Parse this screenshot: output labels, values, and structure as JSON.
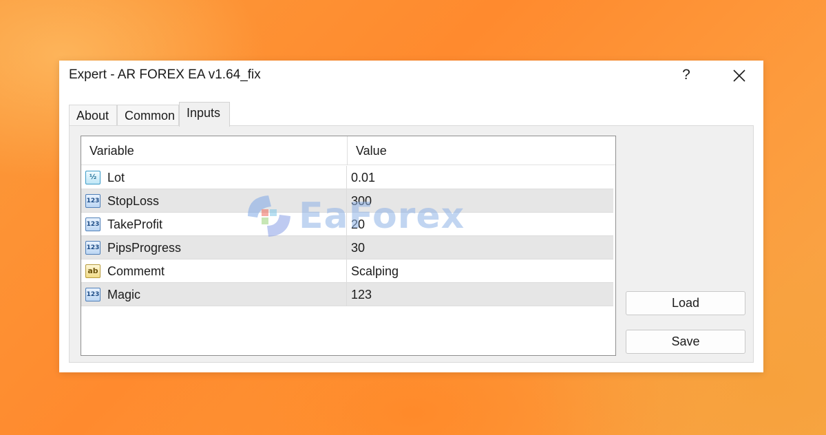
{
  "window": {
    "title": "Expert - AR FOREX EA v1.64_fix",
    "help_label": "?",
    "close_icon": "close-icon"
  },
  "tabs": [
    {
      "label": "About",
      "active": false
    },
    {
      "label": "Common",
      "active": false
    },
    {
      "label": "Inputs",
      "active": true
    }
  ],
  "grid": {
    "columns": [
      "Variable",
      "Value"
    ],
    "rows": [
      {
        "icon": "fraction-type-icon",
        "icon_glyph": "½",
        "variable": "Lot",
        "value": "0.01"
      },
      {
        "icon": "integer-type-icon",
        "icon_glyph": "123",
        "variable": "StopLoss",
        "value": "300"
      },
      {
        "icon": "integer-type-icon",
        "icon_glyph": "123",
        "variable": "TakeProfit",
        "value": "20"
      },
      {
        "icon": "integer-type-icon",
        "icon_glyph": "123",
        "variable": "PipsProgress",
        "value": "30"
      },
      {
        "icon": "string-type-icon",
        "icon_glyph": "ab",
        "variable": "Commemt",
        "value": "Scalping"
      },
      {
        "icon": "integer-type-icon",
        "icon_glyph": "123",
        "variable": "Magic",
        "value": "123"
      }
    ]
  },
  "buttons": {
    "load_label": "Load",
    "save_label": "Save"
  },
  "watermark": {
    "text": "EaForex"
  },
  "colors": {
    "background_orange": "#ff8a2e",
    "dialog_bg": "#ffffff",
    "panel_bg": "#f0f0f0",
    "alt_row_bg": "#e6e6e6"
  }
}
